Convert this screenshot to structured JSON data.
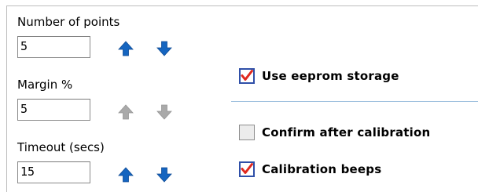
{
  "settings": {
    "points": {
      "label": "Number of points",
      "value": "5",
      "up_enabled": true,
      "down_enabled": true
    },
    "margin": {
      "label": "Margin %",
      "value": "5",
      "up_enabled": false,
      "down_enabled": false
    },
    "timeout": {
      "label": "Timeout (secs)",
      "value": "15",
      "up_enabled": true,
      "down_enabled": true
    }
  },
  "options": {
    "eeprom": {
      "label": "Use eeprom storage",
      "checked": true
    },
    "confirm": {
      "label": "Confirm after calibration",
      "checked": false
    },
    "beeps": {
      "label": "Calibration beeps",
      "checked": true
    }
  },
  "icons": {
    "up": "arrow-up-icon",
    "down": "arrow-down-icon",
    "check": "checkmark-icon"
  },
  "colors": {
    "arrow_enabled": "#1565c0",
    "arrow_disabled": "#a9a9a9",
    "check_mark": "#e0281e",
    "checkbox_border": "#2f4fa8",
    "divider": "#9fc1de"
  }
}
